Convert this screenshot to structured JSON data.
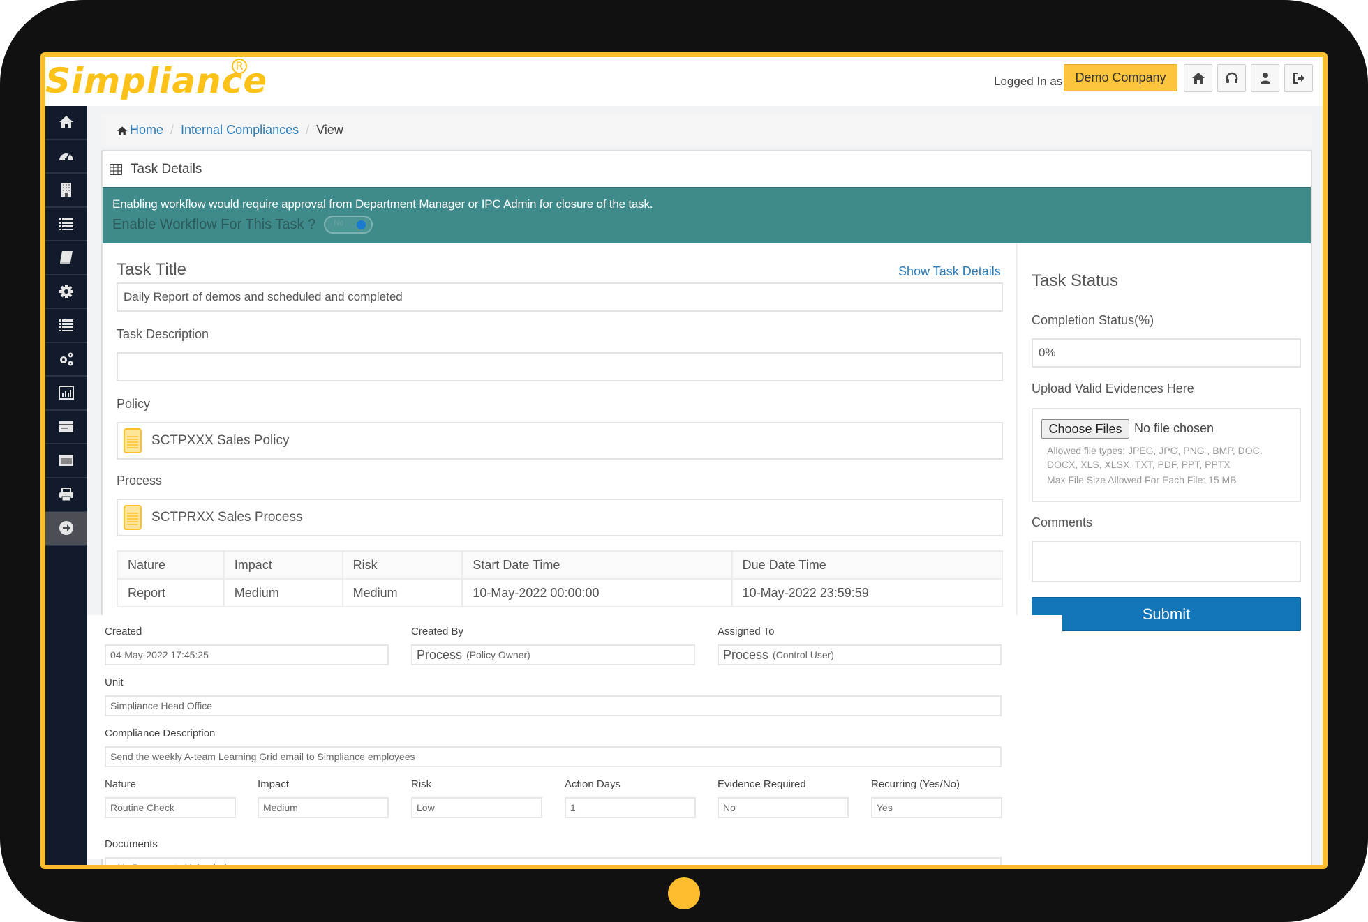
{
  "brand": {
    "logo_text": "Simpliance",
    "registered_mark": "R",
    "accent_color": "#fdbd2c"
  },
  "header": {
    "logged_in_label": "Logged In as",
    "company_button": "Demo Company",
    "icon_buttons": [
      "home-icon",
      "headset-support-icon",
      "user-icon",
      "logout-icon"
    ]
  },
  "sidebar": {
    "items": [
      {
        "icon": "home-icon"
      },
      {
        "icon": "dashboard-gauge-icon"
      },
      {
        "icon": "building-icon"
      },
      {
        "icon": "list-icon"
      },
      {
        "icon": "book-icon"
      },
      {
        "icon": "gear-icon"
      },
      {
        "icon": "list-icon"
      },
      {
        "icon": "gears-icon"
      },
      {
        "icon": "bar-chart-icon"
      },
      {
        "icon": "card-icon"
      },
      {
        "icon": "window-icon"
      },
      {
        "icon": "printer-icon"
      },
      {
        "icon": "arrow-circle-right-icon",
        "active": true
      }
    ]
  },
  "breadcrumb": {
    "home": "Home",
    "section": "Internal Compliances",
    "current": "View",
    "separator": "/"
  },
  "panel": {
    "title": "Task Details"
  },
  "banner": {
    "message": "Enabling workflow would require approval from Department Manager or IPC Admin for closure of the task.",
    "question": "Enable Workflow For This Task ?",
    "toggle_label": "No",
    "toggle_on": false,
    "color": "#3f8a8a"
  },
  "task": {
    "title_label": "Task Title",
    "show_details_link": "Show Task Details",
    "title_value": "Daily Report of demos and scheduled and completed",
    "description_label": "Task Description",
    "description_value": "",
    "policy_label": "Policy",
    "policy_value": "SCTPXXX Sales Policy",
    "process_label": "Process",
    "process_value": "SCTPRXX Sales Process",
    "table": {
      "headers": [
        "Nature",
        "Impact",
        "Risk",
        "Start Date Time",
        "Due Date Time"
      ],
      "rows": [
        [
          "Report",
          "Medium",
          "Medium",
          "10-May-2022 00:00:00",
          "10-May-2022 23:59:59"
        ]
      ]
    }
  },
  "status": {
    "title": "Task Status",
    "completion_label": "Completion Status(%)",
    "completion_value": "0%",
    "upload_label": "Upload Valid Evidences Here",
    "choose_files": "Choose Files",
    "no_file": "No file chosen",
    "allowed_types_line1": "Allowed file types: JPEG, JPG, PNG , BMP, DOC,",
    "allowed_types_line2": "DOCX, XLS, XLSX, TXT, PDF, PPT, PPTX",
    "max_size": "Max File Size Allowed For Each File: 15 MB",
    "comments_label": "Comments",
    "comments_value": "",
    "submit": "Submit",
    "submit_color": "#1376b9"
  },
  "details": {
    "created_label": "Created",
    "created_value": "04-May-2022 17:45:25",
    "created_by_label": "Created By",
    "created_by_name": "Process",
    "created_by_role": "(Policy Owner)",
    "assigned_to_label": "Assigned To",
    "assigned_to_name": "Process",
    "assigned_to_role": "(Control User)",
    "unit_label": "Unit",
    "unit_value": "Simpliance Head Office",
    "compliance_desc_label": "Compliance Description",
    "compliance_desc_value": "Send the weekly A-team Learning Grid email to Simpliance employees",
    "attributes": [
      {
        "label": "Nature",
        "value": "Routine Check"
      },
      {
        "label": "Impact",
        "value": "Medium"
      },
      {
        "label": "Risk",
        "value": "Low"
      },
      {
        "label": "Action Days",
        "value": "1"
      },
      {
        "label": "Evidence Required",
        "value": "No"
      },
      {
        "label": "Recurring (Yes/No)",
        "value": "Yes"
      }
    ],
    "documents_label": "Documents",
    "documents_value": "No Documents Uploaded"
  }
}
